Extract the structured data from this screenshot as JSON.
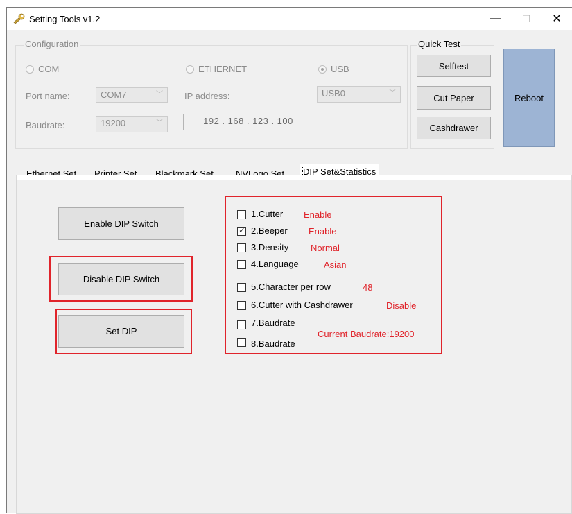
{
  "window": {
    "title": "Setting  Tools v1.2",
    "min_glyph": "—",
    "max_glyph": "☐",
    "close_glyph": "✕"
  },
  "configuration": {
    "label": "Configuration",
    "radios": [
      {
        "label": "COM",
        "checked": false
      },
      {
        "label": "ETHERNET",
        "checked": false
      },
      {
        "label": "USB",
        "checked": true
      }
    ],
    "port_name_label": "Port name:",
    "port_name_value": "COM7",
    "baudrate_label": "Baudrate:",
    "baudrate_value": "19200",
    "ip_label": "IP address:",
    "ip_value": "192 . 168 . 123 . 100",
    "usb_value": "USB0",
    "chevron": "﹀"
  },
  "quick_test": {
    "label": "Quick Test",
    "selftest": "Selftest",
    "cut_paper": "Cut Paper",
    "cashdrawer": "Cashdrawer",
    "reboot": "Reboot"
  },
  "tabs": [
    {
      "label": "Ethernet Set",
      "active": false
    },
    {
      "label": "Printer Set",
      "active": false
    },
    {
      "label": "Blackmark Set",
      "active": false
    },
    {
      "label": "NVLogo Set",
      "active": false
    },
    {
      "label": "DIP Set&Statistics",
      "active": true
    }
  ],
  "dip_panel": {
    "enable_button": "Enable DIP Switch",
    "disable_button": "Disable DIP Switch",
    "set_button": "Set DIP",
    "items": [
      {
        "label": "1.Cutter",
        "value": "Enable",
        "checked": false
      },
      {
        "label": "2.Beeper",
        "value": "Enable",
        "checked": true
      },
      {
        "label": "3.Density",
        "value": "Normal",
        "checked": false
      },
      {
        "label": "4.Language",
        "value": "Asian",
        "checked": false
      },
      {
        "label": "5.Character per row",
        "value": "48",
        "checked": false
      },
      {
        "label": "6.Cutter with Cashdrawer",
        "value": "Disable",
        "checked": false
      },
      {
        "label": "7.Baudrate",
        "value": "",
        "checked": false
      },
      {
        "label": "8.Baudrate",
        "value": "",
        "checked": false
      }
    ],
    "current_baudrate": "Current Baudrate:19200",
    "check_glyph": "✓"
  },
  "colors": {
    "highlight_red": "#e0242b",
    "reboot_blue": "#9db4d4",
    "window_bg": "#f0f0f0"
  }
}
